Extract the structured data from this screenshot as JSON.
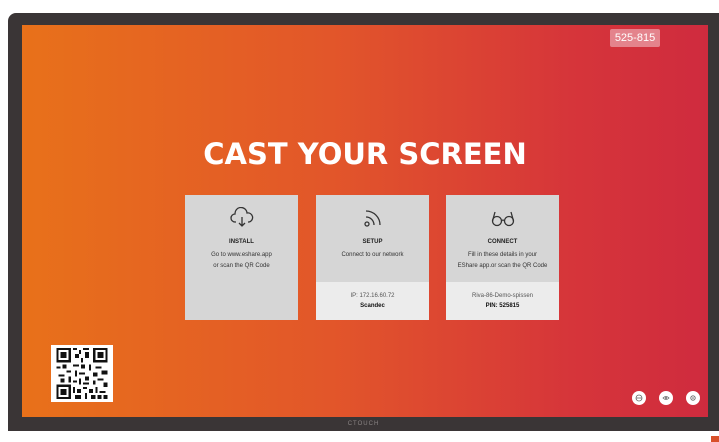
{
  "screen_code": "525-815",
  "title": "CAST YOUR SCREEN",
  "cards": [
    {
      "icon": "cloud-download-icon",
      "heading": "INSTALL",
      "body_line1": "Go to www.eshare.app",
      "body_line2": "or scan the QR Code",
      "footer_line1": "",
      "footer_line2": ""
    },
    {
      "icon": "wifi-signal-icon",
      "heading": "SETUP",
      "body_line1": "Connect to our network",
      "body_line2": "",
      "footer_line1": "IP: 172.16.60.72",
      "footer_line2": "Scandec"
    },
    {
      "icon": "glasses-icon",
      "heading": "CONNECT",
      "body_line1": "Fill in these details in your",
      "body_line2": "EShare app.or scan the QR Code",
      "footer_line1": "Riva-86-Demo-spissen",
      "footer_line2": "PIN: 525815"
    }
  ],
  "brand": "CTOUCH",
  "colors": {
    "gradient_start": "#e8711a",
    "gradient_end": "#cf2b3e",
    "card_bg": "#d6d6d6",
    "card_footer_bg": "#ececec"
  },
  "controls": [
    "settings-circle-icon",
    "eye-icon",
    "gear-icon"
  ]
}
